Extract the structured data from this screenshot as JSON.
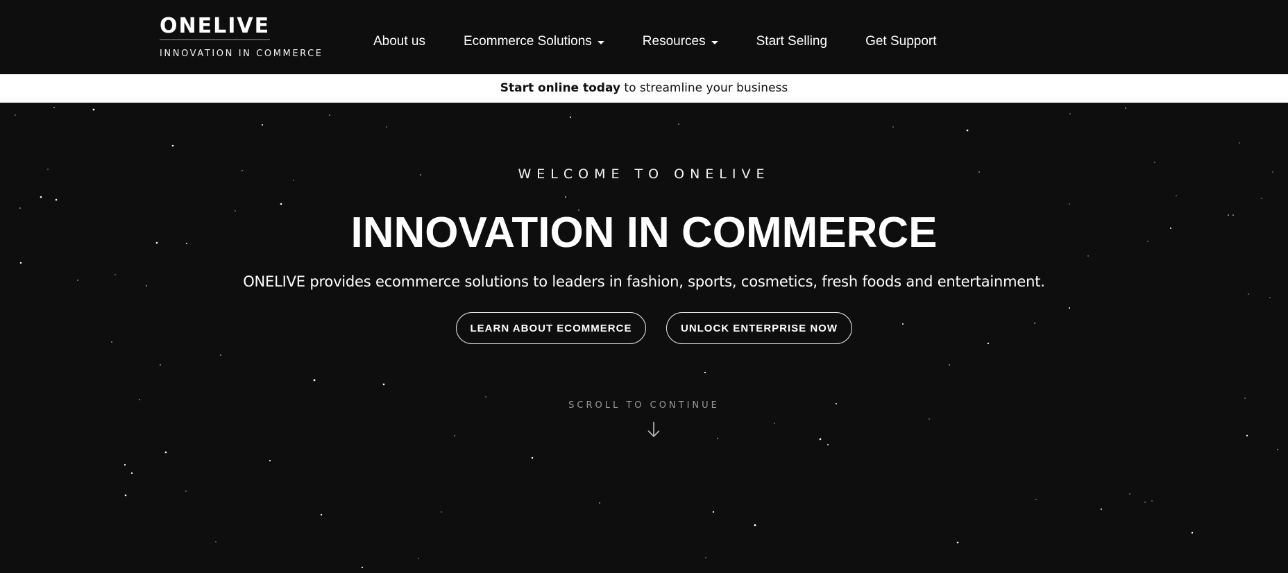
{
  "header": {
    "logo": {
      "name": "ONELIVE",
      "tagline": "INNOVATION IN COMMERCE"
    },
    "nav": [
      {
        "label": "About us",
        "dropdown": false
      },
      {
        "label": "Ecommerce Solutions",
        "dropdown": true
      },
      {
        "label": "Resources",
        "dropdown": true
      },
      {
        "label": "Start Selling",
        "dropdown": false
      },
      {
        "label": "Get Support",
        "dropdown": false
      }
    ]
  },
  "announcement": {
    "bold": "Start online today",
    "rest": " to streamline your business"
  },
  "hero": {
    "eyebrow": "WELCOME TO ONELIVE",
    "headline": "INNOVATION IN COMMERCE",
    "subtitle": "ONELIVE provides ecommerce solutions to leaders in fashion, sports, cosmetics, fresh foods and entertainment.",
    "buttons": {
      "learn": "LEARN ABOUT ECOMMERCE",
      "unlock": "UNLOCK ENTERPRISE NOW"
    },
    "scroll_label": "SCROLL TO CONTINUE",
    "scroll_icon": "arrow-down-icon"
  },
  "colors": {
    "background": "#0e0e0f",
    "text": "#ffffff",
    "announcement_bg": "#ffffff",
    "scroll_text": "#9a9a9a"
  }
}
